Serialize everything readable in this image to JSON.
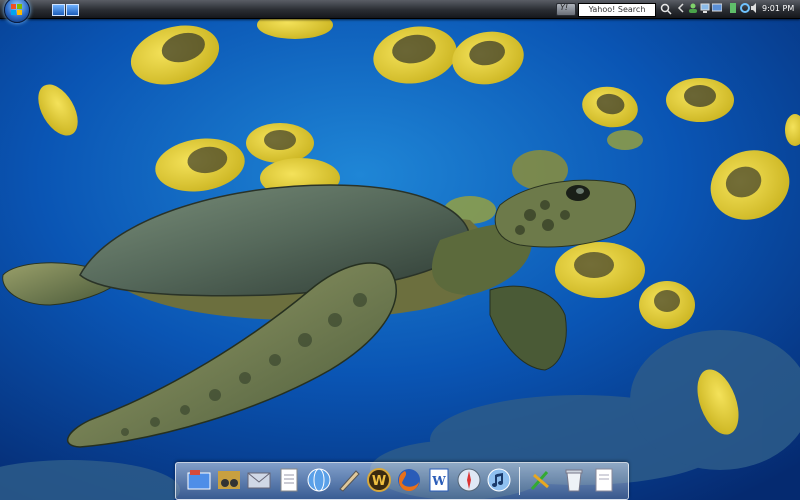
{
  "taskbar": {
    "search_placeholder": "Yahoo! Search",
    "clock": "9:01 PM",
    "yahoo_logo_text": "Y!"
  },
  "dock": {
    "items": [
      "folder-app-icon",
      "photos-app-icon",
      "mail-app-icon",
      "document-app-icon",
      "network-globe-icon",
      "pen-tools-icon",
      "wow-game-icon",
      "firefox-icon",
      "word-icon",
      "safari-icon",
      "itunes-icon",
      "dreamweaver-icon",
      "recycle-bin-icon",
      "text-file-icon"
    ]
  },
  "colors": {
    "taskbar": "#2a2d33",
    "sea": "#0b3f8f",
    "fish_yellow": "#e8d43c"
  }
}
